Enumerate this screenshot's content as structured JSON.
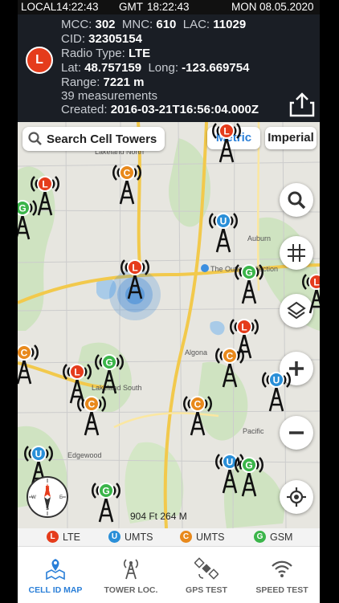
{
  "status": {
    "local_label": "LOCAL",
    "local_time": "14:22:43",
    "gmt_label": "GMT",
    "gmt_time": "18:22:43",
    "day": "MON",
    "date": "08.05.2020"
  },
  "cell": {
    "badge": "L",
    "mcc_label": "MCC:",
    "mcc": "302",
    "mnc_label": "MNC:",
    "mnc": "610",
    "lac_label": "LAC:",
    "lac": "11029",
    "cid_label": "CID:",
    "cid": "32305154",
    "radio_label": "Radio Type:",
    "radio": "LTE",
    "lat_label": "Lat:",
    "lat": "48.757159",
    "long_label": "Long:",
    "long": "-123.669754",
    "range_label": "Range:",
    "range": "7221 m",
    "measurements": "39 measurements",
    "created_label": "Created:",
    "created": "2016-03-21T16:56:04.000Z"
  },
  "map": {
    "search_label": "Search Cell Towers",
    "unit_metric": "Metric",
    "unit_imperial": "Imperial",
    "scale": "904 Ft 264 M",
    "place_labels": [
      "Lakeland North",
      "Auburn",
      "The Outlet Collection",
      "Algona",
      "Lakeland South",
      "Edgewood",
      "Pacific"
    ],
    "compass_labels": [
      "N",
      "E",
      "S",
      "W"
    ]
  },
  "legend": [
    {
      "letter": "L",
      "label": "LTE",
      "color": "#e53c1c"
    },
    {
      "letter": "U",
      "label": "UMTS",
      "color": "#2a8fd8"
    },
    {
      "letter": "C",
      "label": "UMTS",
      "color": "#e8891c"
    },
    {
      "letter": "G",
      "label": "GSM",
      "color": "#3bb54a"
    }
  ],
  "tabs": [
    {
      "label": "CELL ID MAP",
      "icon": "map-pin-icon",
      "active": true
    },
    {
      "label": "TOWER LOC.",
      "icon": "tower-icon",
      "active": false
    },
    {
      "label": "GPS TEST",
      "icon": "satellite-icon",
      "active": false
    },
    {
      "label": "SPEED TEST",
      "icon": "wifi-icon",
      "active": false
    }
  ],
  "accent": "#2a7fd8"
}
